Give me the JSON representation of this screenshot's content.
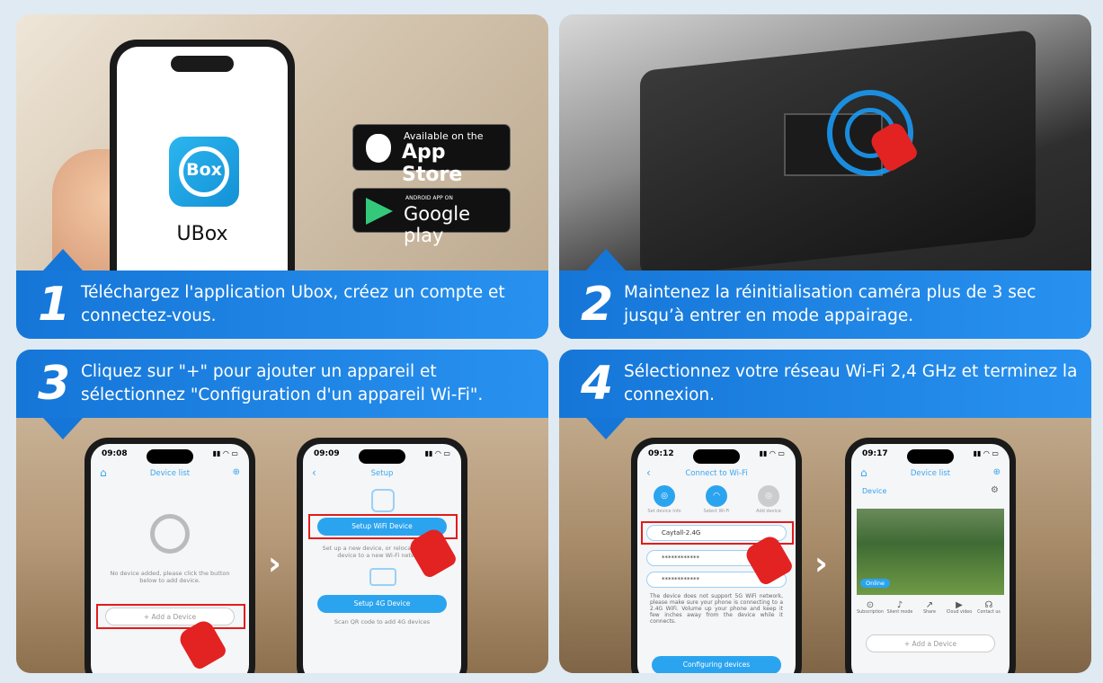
{
  "steps": [
    {
      "num": "1",
      "text": "Téléchargez l'application Ubox, créez un compte et connectez-vous."
    },
    {
      "num": "2",
      "text": "Maintenez la réinitialisation caméra plus de 3 sec jusqu’à entrer en mode appairage."
    },
    {
      "num": "3",
      "text": "Cliquez sur \"+\" pour ajouter un appareil et sélectionnez \"Configuration d'un appareil Wi-Fi\"."
    },
    {
      "num": "4",
      "text": "Sélectionnez votre réseau Wi-Fi 2,4 GHz et terminez la connexion."
    }
  ],
  "panel1": {
    "app_icon_text": "Box",
    "app_name": "UBox",
    "appstore": {
      "sub": "Available on the",
      "main": "App Store"
    },
    "googleplay": {
      "sub": "ANDROID APP ON",
      "main": "Google play"
    }
  },
  "phone_a": {
    "time": "09:08",
    "title": "Device list",
    "empty_text": "No device added, please click the button below to add device.",
    "add_button": "+ Add a Device"
  },
  "phone_b": {
    "time": "09:09",
    "title": "Setup",
    "wifi_button": "Setup WiFi Device",
    "wifi_desc": "Set up a new device, or relocate existing device to a new Wi-Fi network.",
    "g4_button": "Setup 4G Device",
    "g4_desc": "Scan QR code to add 4G devices"
  },
  "phone_c": {
    "time": "09:12",
    "title": "Connect to Wi-Fi",
    "steps": [
      "Set device info",
      "Select Wi-Fi",
      "Add device"
    ],
    "ssid": "Caytall-2.4G",
    "password": "************",
    "password2": "************",
    "note": "The device does not support 5G WiFi network, please make sure your phone is connecting to a 2.4G WiFi. Volume up your phone and keep it few inches away from the device while it connects.",
    "button": "Configuring devices"
  },
  "phone_d": {
    "time": "09:17",
    "title": "Device list",
    "device_label": "Device",
    "online": "Online",
    "actions": [
      "Subscription",
      "Silent mode",
      "Share",
      "Cloud video",
      "Contact us"
    ],
    "add_button": "+ Add a Device"
  }
}
